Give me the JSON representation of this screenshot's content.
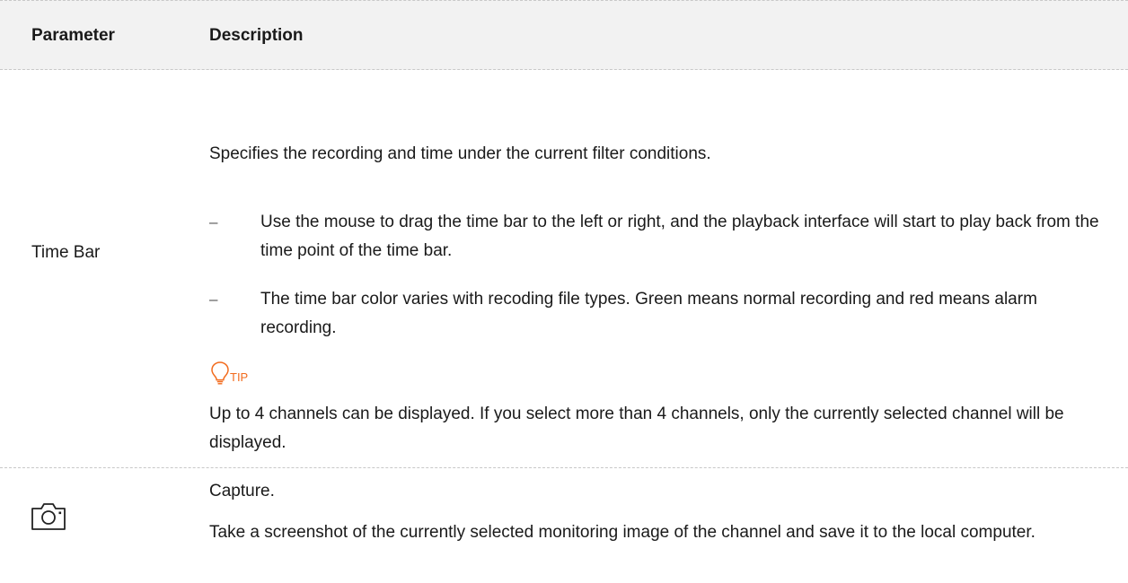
{
  "table": {
    "headers": {
      "parameter": "Parameter",
      "description": "Description"
    },
    "rows": [
      {
        "parameter": "Time Bar",
        "intro": "Specifies the recording and time under the current filter conditions.",
        "bullets": [
          {
            "marker": "–",
            "text": "Use the mouse to drag the time bar to the left or right, and the playback interface will start to play back from the time point of the time bar."
          },
          {
            "marker": "–",
            "text": "The time bar color varies with recoding file types. Green means normal recording and red means alarm recording."
          }
        ],
        "tip": {
          "icon": "lightbulb-icon",
          "label": "TIP",
          "color": "#f26b1d",
          "text": "Up to 4 channels can be displayed. If you select more than 4 channels, only the currently selected channel will be displayed."
        }
      },
      {
        "parameter_icon": "camera-icon",
        "title": "Capture.",
        "text": "Take a screenshot of the currently selected monitoring image of the channel and save it to the local computer."
      }
    ]
  }
}
